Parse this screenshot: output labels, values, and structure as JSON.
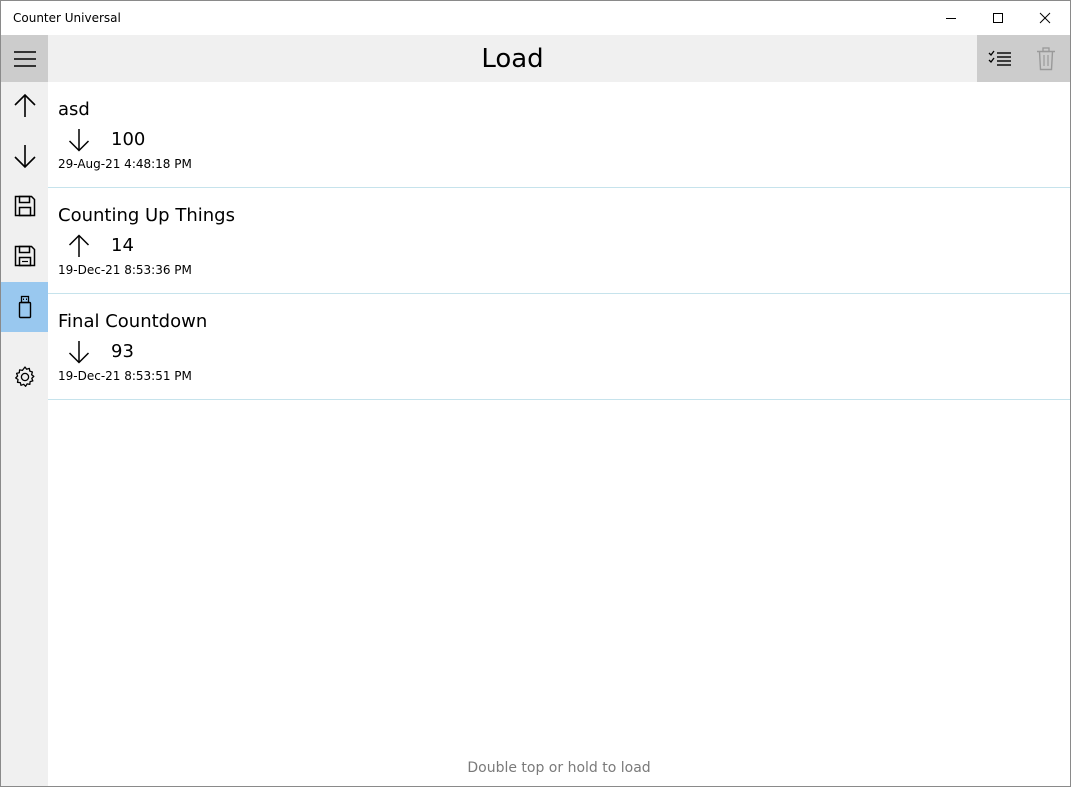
{
  "window": {
    "title": "Counter Universal"
  },
  "header": {
    "title": "Load"
  },
  "sidebar": {
    "items": [
      {
        "name": "hamburger-menu",
        "icon": "hamburger-icon"
      },
      {
        "name": "count-up",
        "icon": "arrow-up-icon"
      },
      {
        "name": "count-down",
        "icon": "arrow-down-icon"
      },
      {
        "name": "save",
        "icon": "save-icon"
      },
      {
        "name": "save-as",
        "icon": "save-as-icon"
      },
      {
        "name": "load",
        "icon": "usb-drive-icon",
        "active": true
      },
      {
        "name": "settings",
        "icon": "gear-icon"
      }
    ]
  },
  "commands": [
    {
      "name": "select-mode",
      "icon": "checklist-icon"
    },
    {
      "name": "delete",
      "icon": "trash-icon",
      "disabled": true
    }
  ],
  "counters": [
    {
      "name": "asd",
      "direction": "down",
      "value": "100",
      "date": "29-Aug-21 4:48:18 PM"
    },
    {
      "name": "Counting Up Things",
      "direction": "up",
      "value": "14",
      "date": "19-Dec-21 8:53:36 PM"
    },
    {
      "name": "Final Countdown",
      "direction": "down",
      "value": "93",
      "date": "19-Dec-21 8:53:51 PM"
    }
  ],
  "footer": {
    "hint": "Double top or hold to load"
  },
  "colors": {
    "active_nav": "#99c8ef",
    "chrome_bg": "#f0f0f0",
    "divider": "#c6e3ec",
    "hint_text": "#7a7a7a"
  }
}
